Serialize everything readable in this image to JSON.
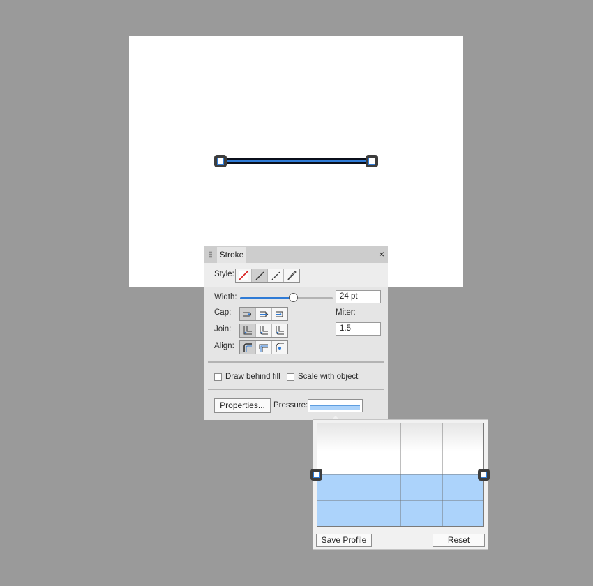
{
  "panel": {
    "tab_title": "Stroke",
    "close_glyph": "×",
    "style_label": "Style:",
    "style_buttons": [
      "none-style-icon",
      "solid-line-style-icon",
      "dashed-line-style-icon",
      "brush-style-icon"
    ],
    "selected_style": "solid-line-style-icon",
    "width_label": "Width:",
    "width_value": "24 pt",
    "width_slider_fraction": 0.57,
    "cap_label": "Cap:",
    "join_label": "Join:",
    "align_label": "Align:",
    "miter_label": "Miter:",
    "miter_value": "1.5",
    "cap_buttons": [
      "butt-cap-icon",
      "round-cap-icon",
      "square-cap-icon"
    ],
    "join_buttons": [
      "miter-join-icon",
      "round-join-icon",
      "bevel-join-icon"
    ],
    "align_buttons": [
      "align-inside-icon",
      "align-center-icon",
      "align-outside-icon"
    ],
    "draw_behind_fill_label": "Draw behind fill",
    "draw_behind_fill_checked": false,
    "scale_with_object_label": "Scale with object",
    "scale_with_object_checked": false,
    "properties_button_label": "Properties...",
    "pressure_label": "Pressure:"
  },
  "pressure_popup": {
    "level_fraction": 0.5,
    "save_profile_label": "Save Profile",
    "reset_label": "Reset"
  },
  "colors": {
    "accent": "#2f7bd6",
    "pressure_fill": "#acd3fb",
    "background": "#9a9a9a"
  }
}
